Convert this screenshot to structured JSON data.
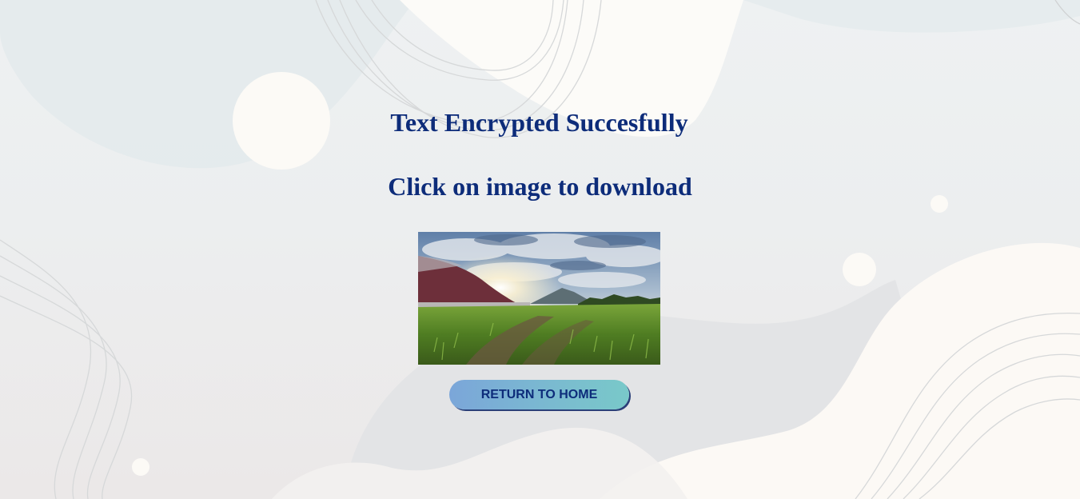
{
  "result": {
    "title": "Text Encrypted Succesfully",
    "instruction": "Click on image to download"
  },
  "download_image": {
    "description_icon": "landscape-image"
  },
  "actions": {
    "return_home_label": "RETURN TO HOME"
  },
  "colors": {
    "heading": "#0d2c7a",
    "button_gradient_start": "#7ba6d9",
    "button_gradient_end": "#79c9c9",
    "button_shadow": "#2a3f78"
  }
}
